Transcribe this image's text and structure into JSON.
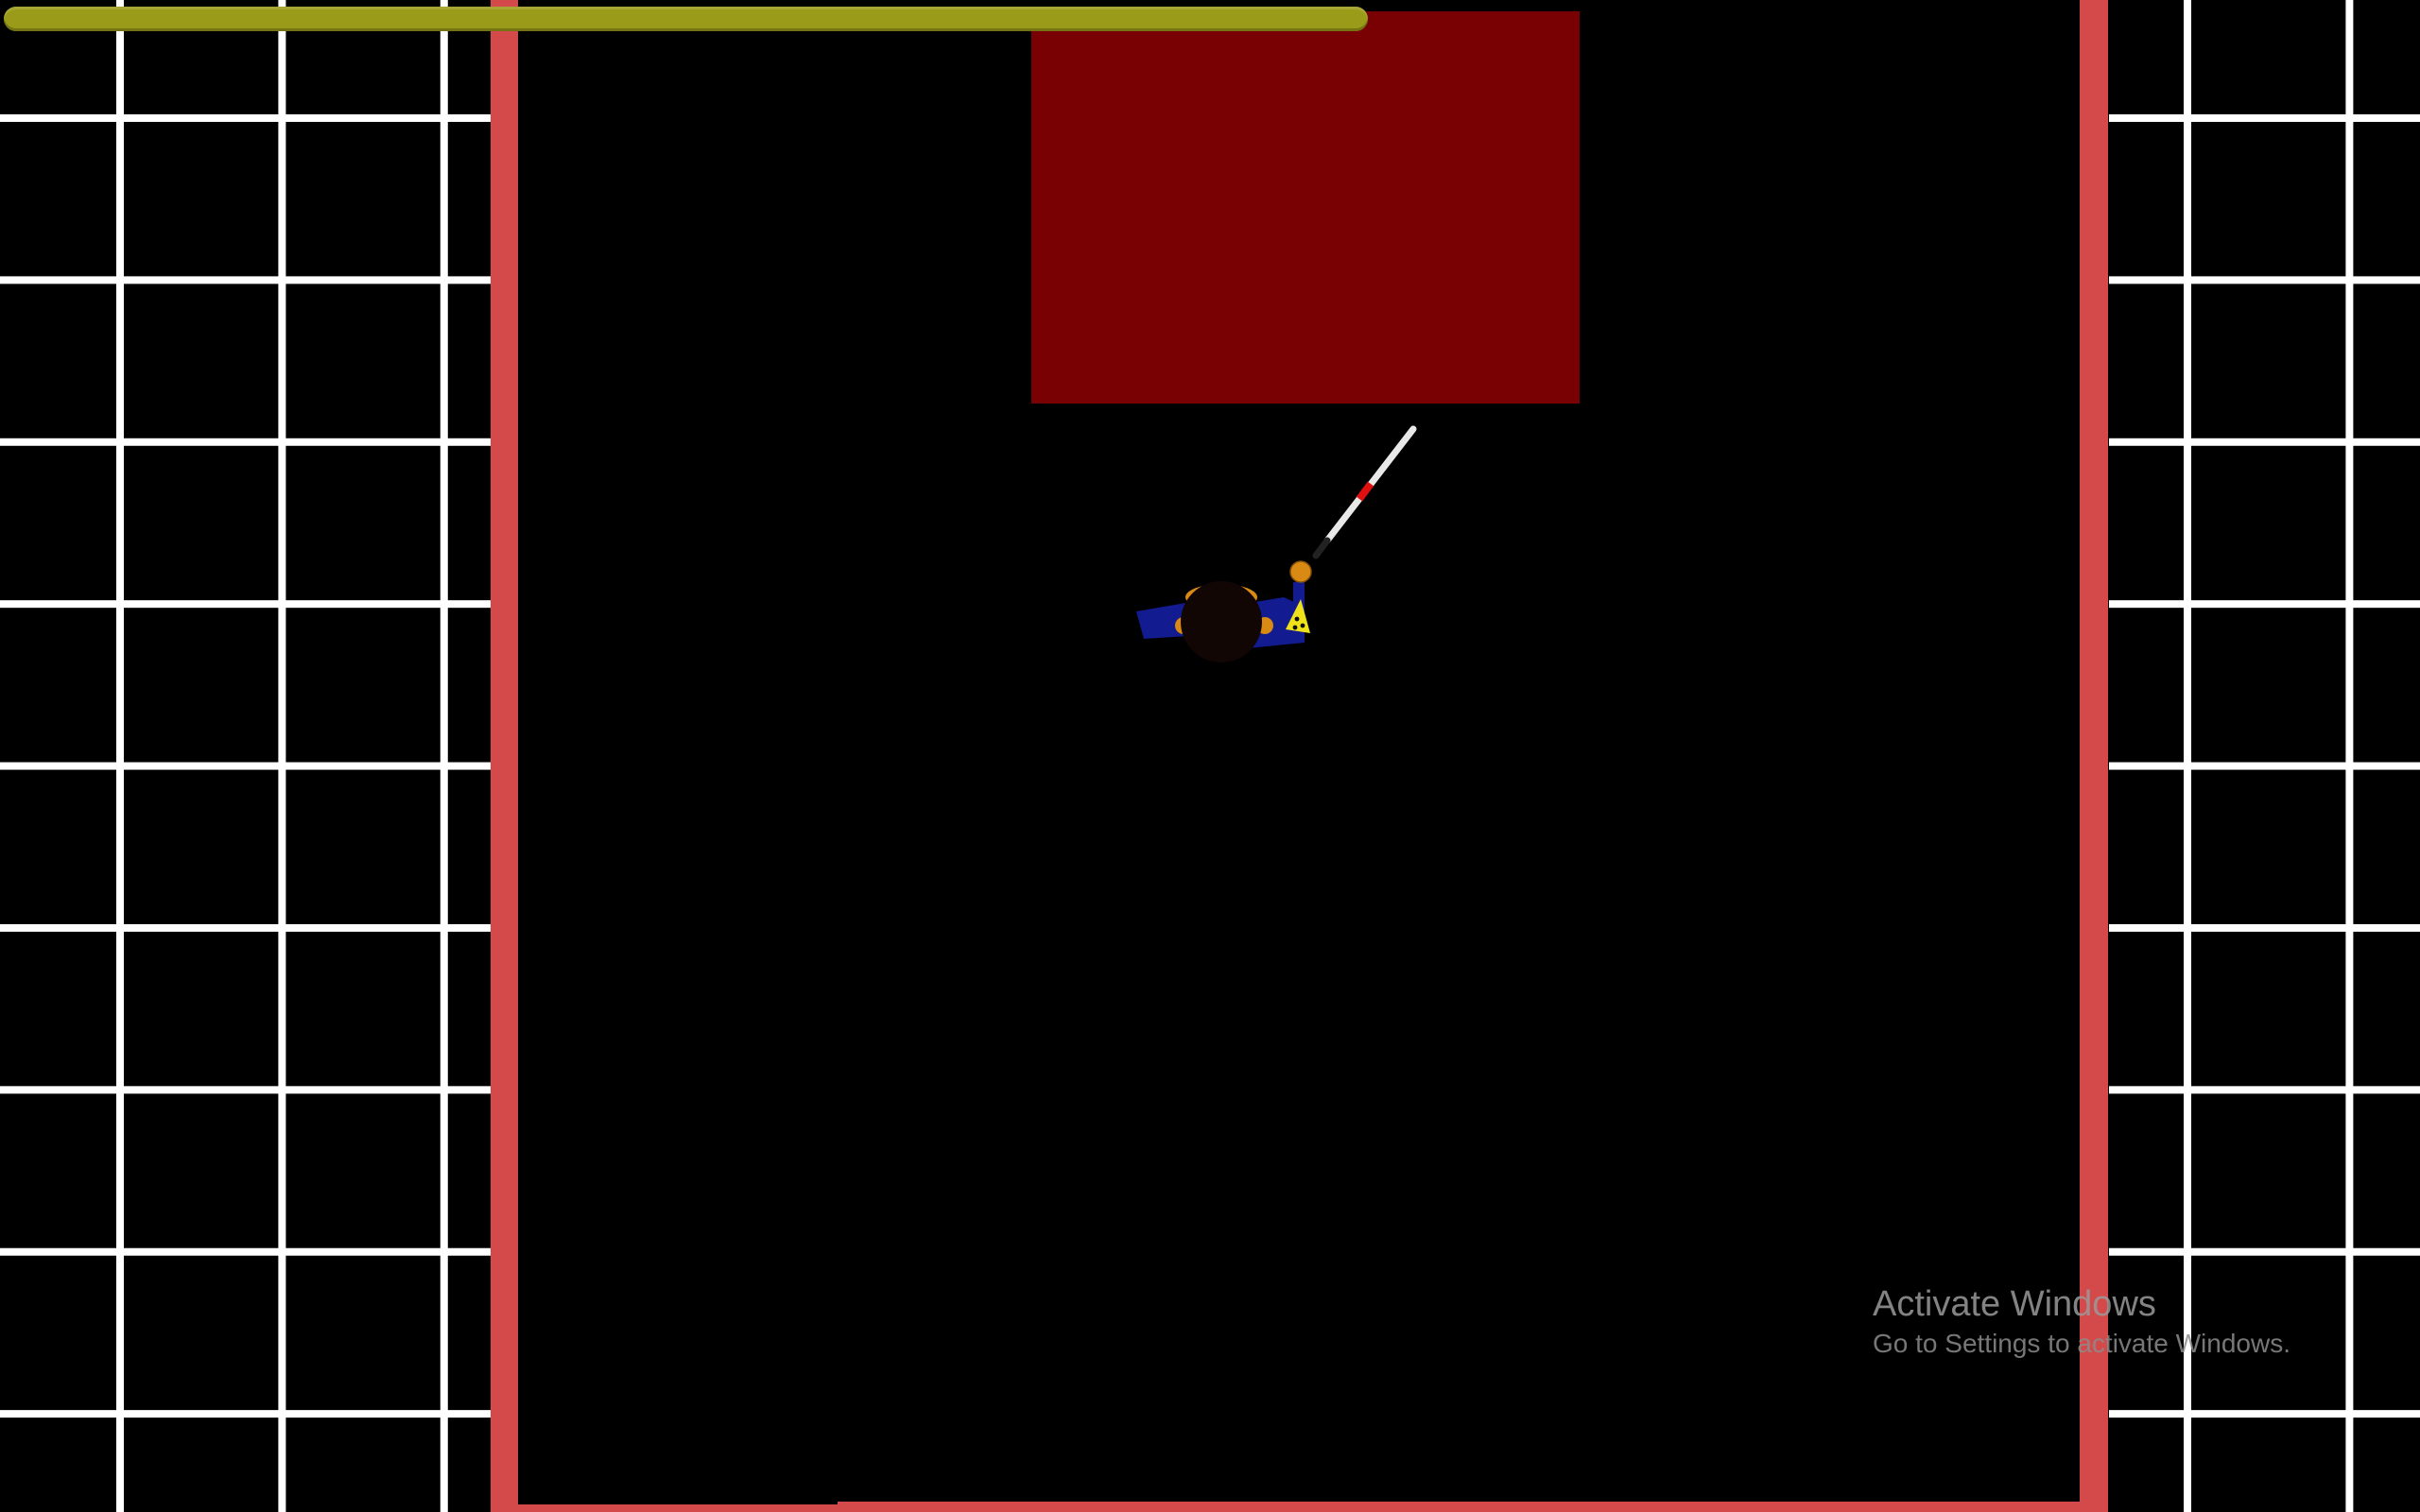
{
  "game": {
    "health": {
      "fraction": 1.0,
      "color_fill": "#9b9b1a",
      "color_track": "#6f6f0c"
    },
    "colors": {
      "background": "#000000",
      "grid_lines": "#ffffff",
      "walls": "#d44a4a",
      "red_block": "#790103",
      "player_shirt": "#121b8f",
      "player_head": "#120604",
      "player_hair": "#d98a15",
      "stick_shaft": "#e8e8e8",
      "stick_band": "#e01010",
      "backpack": "#f0e21a"
    },
    "player": {
      "icon": "player-top-down-icon",
      "held_item_icon": "white-cane-icon"
    }
  },
  "os_watermark": {
    "title": "Activate Windows",
    "subtitle": "Go to Settings to activate Windows."
  }
}
